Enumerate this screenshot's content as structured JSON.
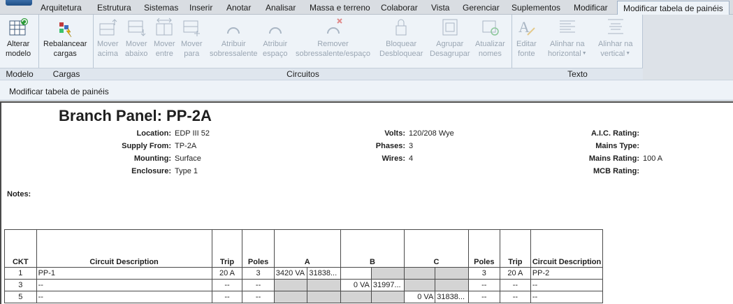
{
  "tabs": [
    {
      "label": "Arquitetura"
    },
    {
      "label": "Estrutura"
    },
    {
      "label": "Sistemas"
    },
    {
      "label": "Inserir"
    },
    {
      "label": "Anotar"
    },
    {
      "label": "Analisar"
    },
    {
      "label": "Massa e terreno"
    },
    {
      "label": "Colaborar"
    },
    {
      "label": "Vista"
    },
    {
      "label": "Gerenciar"
    },
    {
      "label": "Suplementos"
    },
    {
      "label": "Modificar"
    },
    {
      "label": "Modificar tabela de painéis",
      "active": true
    }
  ],
  "ribbon": {
    "panels": {
      "modelo": "Modelo",
      "cargas": "Cargas",
      "circuitos": "Circuitos",
      "texto": "Texto"
    },
    "buttons": {
      "alterar_modelo": [
        "Alterar",
        "modelo"
      ],
      "rebalancear": [
        "Rebalancear",
        "cargas"
      ],
      "mover_acima": [
        "Mover",
        "acima"
      ],
      "mover_abaixo": [
        "Mover",
        "abaixo"
      ],
      "mover_entre": [
        "Mover",
        "entre"
      ],
      "mover_para": [
        "Mover",
        "para"
      ],
      "atribuir_sobressalente": [
        "Atribuir",
        "sobressalente"
      ],
      "atribuir_espaco": [
        "Atribuir",
        "espaço"
      ],
      "remover": [
        "Remover",
        "sobressalente/espaço"
      ],
      "bloquear": [
        "Bloquear",
        "Desbloquear"
      ],
      "agrupar": [
        "Agrupar",
        "Desagrupar"
      ],
      "atualizar": [
        "Atualizar",
        "nomes"
      ],
      "editar_fonte": [
        "Editar",
        "fonte"
      ],
      "alinhar_h": [
        "Alinhar na",
        "horizontal"
      ],
      "alinhar_v": [
        "Alinhar na",
        "vertical"
      ]
    }
  },
  "options_bar": {
    "context": "Modificar tabela de painéis"
  },
  "panel": {
    "title": "Branch Panel: PP-2A",
    "left": [
      {
        "k": "Location:",
        "v": "EDP III 52"
      },
      {
        "k": "Supply From:",
        "v": "TP-2A"
      },
      {
        "k": "Mounting:",
        "v": "Surface"
      },
      {
        "k": "Enclosure:",
        "v": "Type 1"
      }
    ],
    "mid": [
      {
        "k": "Volts:",
        "v": "120/208 Wye"
      },
      {
        "k": "Phases:",
        "v": "3"
      },
      {
        "k": "Wires:",
        "v": "4"
      }
    ],
    "right": [
      {
        "k": "A.I.C. Rating:",
        "v": ""
      },
      {
        "k": "Mains Type:",
        "v": ""
      },
      {
        "k": "Mains Rating:",
        "v": "100 A"
      },
      {
        "k": "MCB Rating:",
        "v": ""
      }
    ],
    "notes_label": "Notes:"
  },
  "table": {
    "headers": [
      "CKT",
      "Circuit Description",
      "Trip",
      "Poles",
      "A",
      "B",
      "C",
      "Poles",
      "Trip",
      "Circuit Description"
    ],
    "rows": [
      {
        "ckt": "1",
        "desc": "PP-1",
        "trip": "20 A",
        "poles": "3",
        "a1": "3420 VA",
        "a2": "31838...",
        "b1": "",
        "b2": "",
        "c1": "",
        "c2": "",
        "poles_r": "3",
        "trip_r": "20 A",
        "desc_r": "PP-2"
      },
      {
        "ckt": "3",
        "desc": "--",
        "trip": "--",
        "poles": "--",
        "a1": "",
        "a2": "",
        "b1": "0 VA",
        "b2": "31997...",
        "c1": "",
        "c2": "",
        "poles_r": "--",
        "trip_r": "--",
        "desc_r": "--"
      },
      {
        "ckt": "5",
        "desc": "--",
        "trip": "--",
        "poles": "--",
        "a1": "",
        "a2": "",
        "b1": "",
        "b2": "",
        "c1": "0 VA",
        "c2": "31838...",
        "poles_r": "--",
        "trip_r": "--",
        "desc_r": "--"
      }
    ]
  }
}
